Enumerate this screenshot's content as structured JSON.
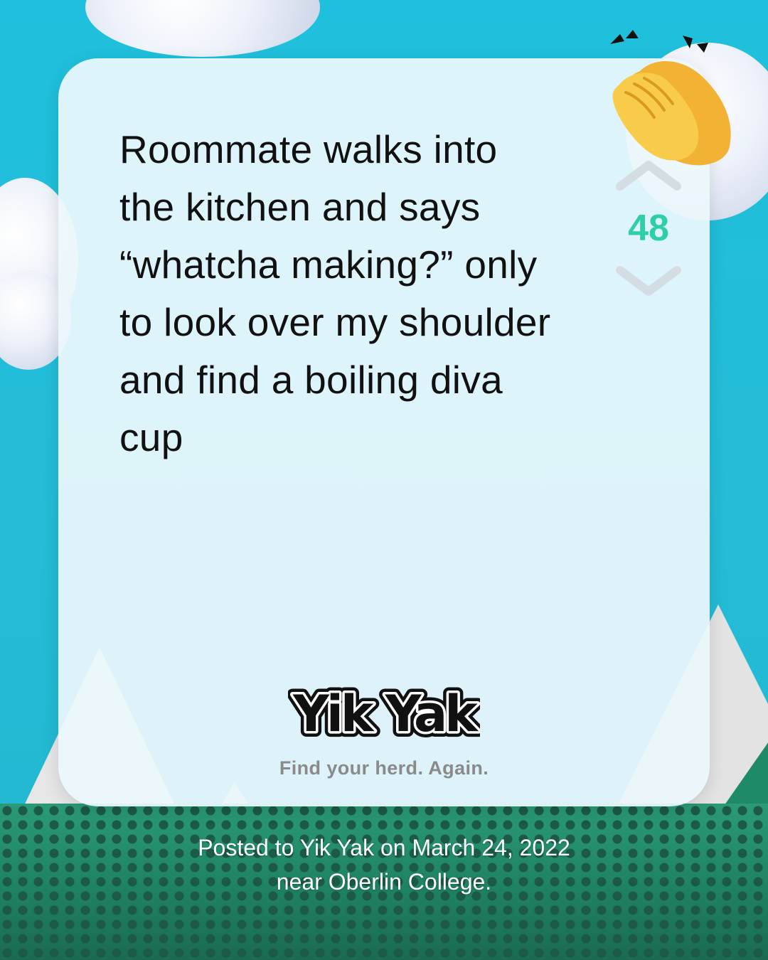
{
  "post": {
    "lines": [
      "Roommate walks into",
      "the kitchen and says",
      "“whatcha making?” only",
      "to look over my shoulder",
      "and find a boiling diva",
      "cup"
    ]
  },
  "vote": {
    "count": "48",
    "upvote_icon": "chevron-up-icon",
    "downvote_icon": "chevron-down-icon"
  },
  "badge": {
    "icon": "clapping-hands-icon"
  },
  "brand": {
    "logo_text": "Yik Yak",
    "tagline": "Find your herd. Again."
  },
  "footer": {
    "line1": "Posted to Yik Yak on March 24, 2022",
    "line2": "near Oberlin College."
  },
  "colors": {
    "vote_count": "#2ecfa7",
    "background": "#22bcd8",
    "card": "#ecf8fc",
    "tagline": "#8a8a8a"
  }
}
